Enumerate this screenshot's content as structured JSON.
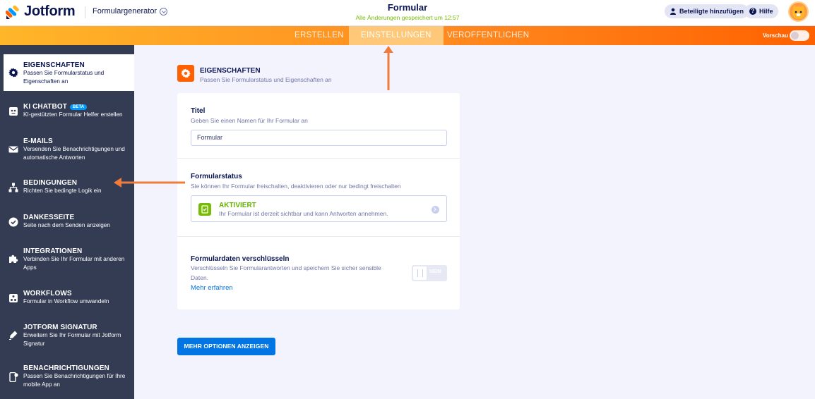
{
  "app": {
    "brand": "Jotform",
    "form_generator": "Formulargenerator"
  },
  "header": {
    "title": "Formular",
    "saved_status": "Alle Änderungen gespeichert um 12:57",
    "add_participants": "Beteiligte hinzufügen",
    "help": "Hilfe"
  },
  "nav": {
    "tabs": [
      {
        "label": "ERSTELLEN",
        "active": false
      },
      {
        "label": "EINSTELLUNGEN",
        "active": true
      },
      {
        "label": "VERÖFFENTLICHEN",
        "active": false
      }
    ],
    "preview_label": "Vorschau"
  },
  "sidebar": {
    "items": [
      {
        "title": "EIGENSCHAFTEN",
        "desc": "Passen Sie Formularstatus und Eigenschaften an",
        "icon": "gear-icon",
        "active": true
      },
      {
        "title": "KI CHATBOT",
        "badge": "BETA",
        "desc": "KI-gestützten Formular Helfer erstellen",
        "icon": "robot-icon"
      },
      {
        "title": "E-MAILS",
        "desc": "Versenden Sie Benachrichtigungen und automatische Antworten",
        "icon": "envelope-icon"
      },
      {
        "title": "BEDINGUNGEN",
        "desc": "Richten Sie bedingte Logik ein",
        "icon": "hierarchy-icon"
      },
      {
        "title": "DANKESSEITE",
        "desc": "Seite nach dem Senden anzeigen",
        "icon": "check-circle-icon"
      },
      {
        "title": "INTEGRATIONEN",
        "desc": "Verbinden Sie Ihr Formular mit anderen Apps",
        "icon": "puzzle-icon"
      },
      {
        "title": "WORKFLOWS",
        "desc": "Formular in Workflow umwandeln",
        "icon": "workflow-icon"
      },
      {
        "title": "JOTFORM SIGNATUR",
        "desc": "Erweitern Sie Ihr Formular mit Jotform Signatur",
        "icon": "pen-icon"
      },
      {
        "title": "BENACHRICHTIGUNGEN",
        "desc": "Passen Sie Benachrichtigungen für Ihre mobile App an",
        "icon": "mobile-bell-icon"
      }
    ]
  },
  "main": {
    "section_title": "EIGENSCHAFTEN",
    "section_desc": "Passen Sie Formularstatus und Eigenschaften an",
    "title_field": {
      "label": "Titel",
      "desc": "Geben Sie einen Namen für Ihr Formular an",
      "value": "Formular"
    },
    "status": {
      "label": "Formularstatus",
      "desc": "Sie können Ihr Formular freischalten, deaktivieren oder nur bedingt freischalten",
      "value_title": "AKTIVIERT",
      "value_desc": "Ihr Formular ist derzeit sichtbar und kann Antworten annehmen."
    },
    "encrypt": {
      "label": "Formulardaten verschlüsseln",
      "desc_line1": "Verschlüsseln Sie Formularantworten und speichern Sie sicher sensible",
      "desc_line2": "Daten.",
      "toggle_label": "NEIN",
      "learn_more": "Mehr erfahren"
    },
    "more_options": "MEHR OPTIONEN ANZEIGEN"
  },
  "colors": {
    "accent": "#ff6100",
    "primary_blue": "#0075e3",
    "sidebar_bg": "#343c54",
    "active_green": "#78bb07",
    "annotation_arrow": "#f07c3c"
  }
}
